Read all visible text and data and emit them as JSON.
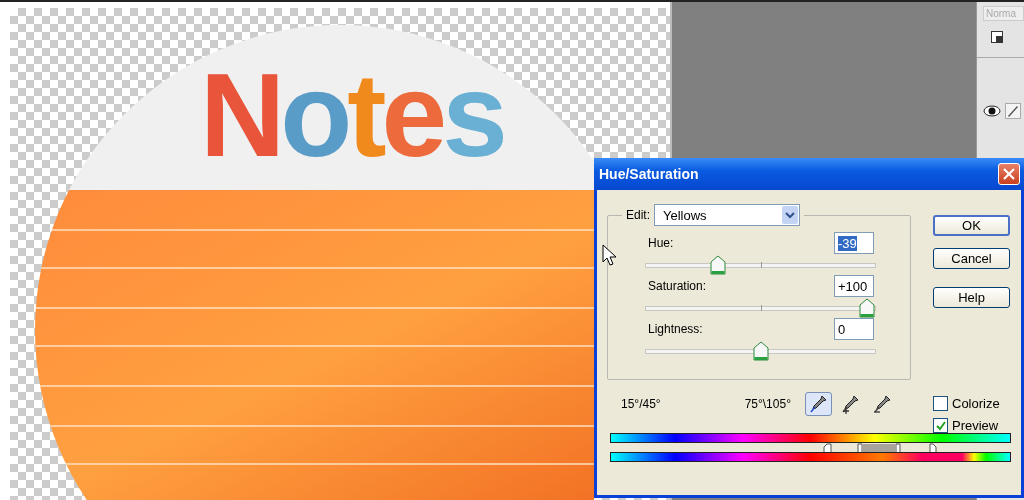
{
  "canvas": {
    "title": "Notes"
  },
  "layers_panel": {
    "blend_mode": "Norma"
  },
  "dialog": {
    "title": "Hue/Saturation",
    "edit": {
      "label": "Edit:",
      "value": "Yellows"
    },
    "sliders": [
      {
        "label": "Hue:",
        "value": "-39",
        "value_selected": true,
        "level": 0.3
      },
      {
        "label": "Saturation:",
        "value": "+100",
        "value_selected": false,
        "level": 1
      },
      {
        "label": "Lightness:",
        "value": "0",
        "value_selected": false,
        "level": 0.5
      }
    ],
    "buttons": [
      {
        "label": "OK",
        "default": true
      },
      {
        "label": "Cancel",
        "default": false
      },
      {
        "label": "Help",
        "default": false
      }
    ],
    "range_left": "15°/45°",
    "range_right": "75°\\105°",
    "eyedroppers": [
      {
        "kind": "sample",
        "selected": true
      },
      {
        "kind": "add",
        "selected": false
      },
      {
        "kind": "subtract",
        "selected": false
      }
    ],
    "options": [
      {
        "label": "Colorize",
        "checked": false
      },
      {
        "label": "Preview",
        "checked": true
      }
    ]
  }
}
